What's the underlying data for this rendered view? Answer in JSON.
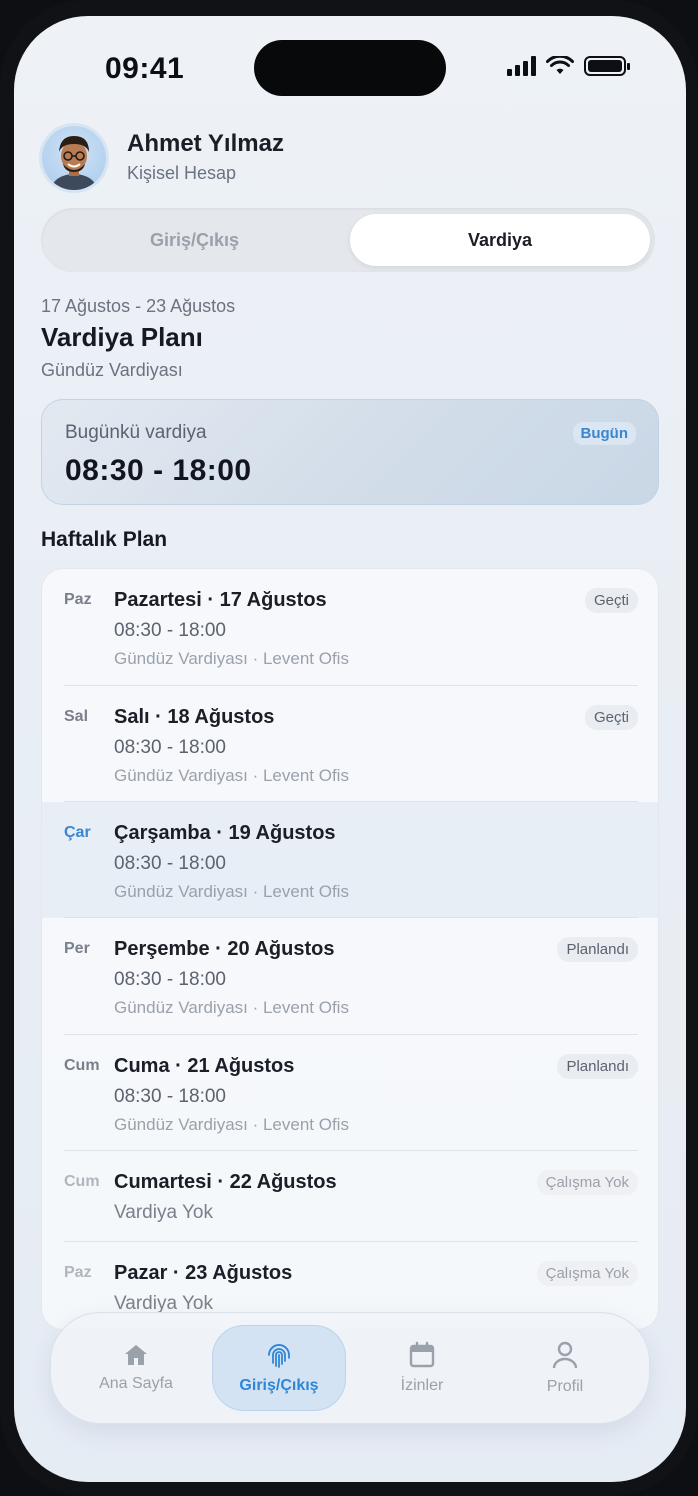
{
  "status_bar": {
    "time": "09:41"
  },
  "user": {
    "name": "Ahmet Yılmaz",
    "account_type": "Kişisel Hesap"
  },
  "segmented": {
    "left_label": "Giriş/Çıkış",
    "right_label": "Vardiya",
    "selected": "Vardiya"
  },
  "plan": {
    "date_range": "17 Ağustos - 23 Ağustos",
    "title": "Vardiya Planı",
    "subtitle": "Gündüz Vardiyası"
  },
  "today": {
    "label": "Bugünkü vardiya",
    "time": "08:30 - 18:00",
    "badge": "Bugün"
  },
  "weekly": {
    "title": "Haftalık Plan",
    "days": [
      {
        "abbr": "Paz",
        "day": "Pazartesi · 17 Ağustos",
        "hours": "08:30 - 18:00",
        "location": "Gündüz Vardiyası · Levent Ofis",
        "badge": "Geçti"
      },
      {
        "abbr": "Sal",
        "day": "Salı · 18 Ağustos",
        "hours": "08:30 - 18:00",
        "location": "Gündüz Vardiyası · Levent Ofis",
        "badge": "Geçti"
      },
      {
        "abbr": "Çar",
        "day": "Çarşamba · 19 Ağustos",
        "hours": "08:30 - 18:00",
        "location": "Gündüz Vardiyası · Levent Ofis",
        "badge": ""
      },
      {
        "abbr": "Per",
        "day": "Perşembe · 20 Ağustos",
        "hours": "08:30 - 18:00",
        "location": "Gündüz Vardiyası · Levent Ofis",
        "badge": "Planlandı"
      },
      {
        "abbr": "Cum",
        "day": "Cuma · 21 Ağustos",
        "hours": "08:30 - 18:00",
        "location": "Gündüz Vardiyası · Levent Ofis",
        "badge": "Planlandı"
      },
      {
        "abbr": "Cum",
        "day": "Cumartesi · 22 Ağustos",
        "hours": "Vardiya Yok",
        "location": "",
        "badge": "Çalışma Yok"
      },
      {
        "abbr": "Paz",
        "day": "Pazar · 23 Ağustos",
        "hours": "Vardiya Yok",
        "location": "",
        "badge": "Çalışma Yok"
      }
    ]
  },
  "tabbar": {
    "tabs": [
      {
        "label": "Ana Sayfa",
        "icon": "home-icon"
      },
      {
        "label": "Giriş/Çıkış",
        "icon": "fingerprint-icon"
      },
      {
        "label": "İzinler",
        "icon": "calendar-icon"
      },
      {
        "label": "Profil",
        "icon": "person-icon"
      }
    ],
    "active": "Giriş/Çıkış"
  },
  "colors": {
    "accent": "#2f86d6",
    "today_row": "#e7eef6",
    "muted": "#9aa1ab"
  }
}
